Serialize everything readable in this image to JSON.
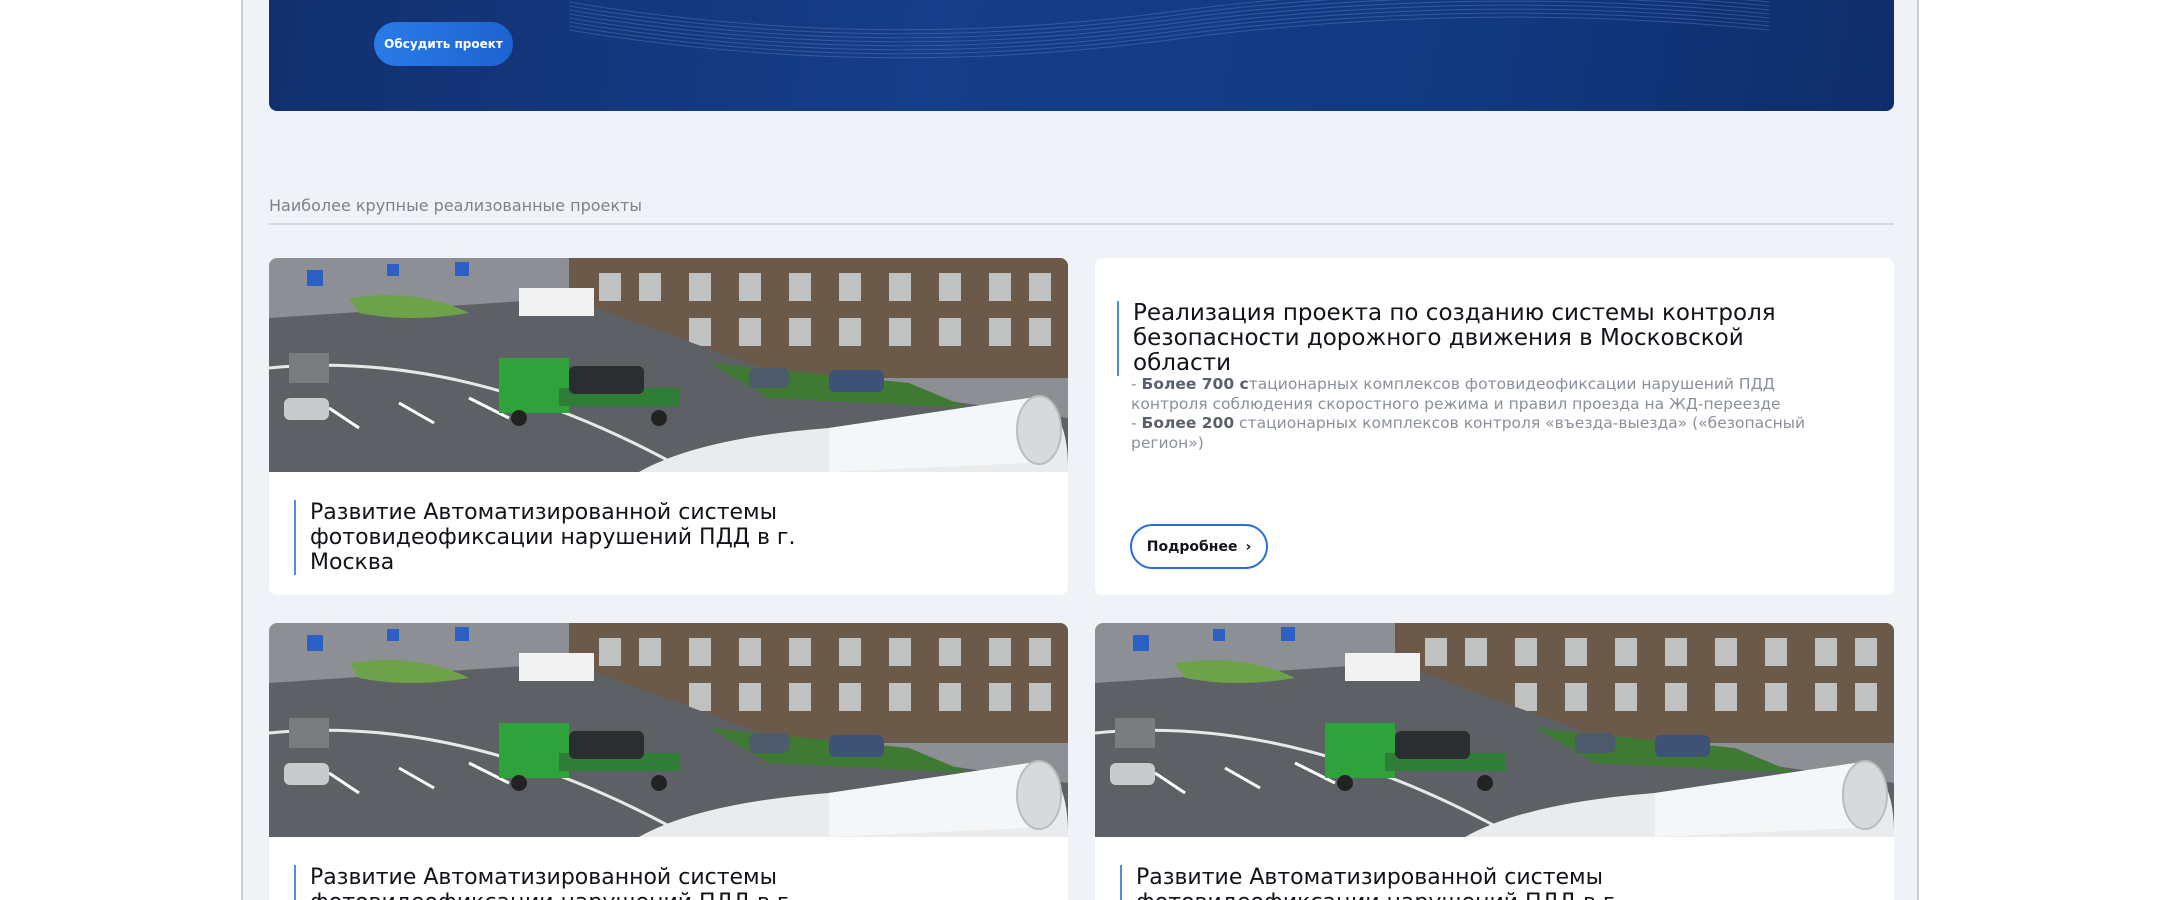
{
  "banner": {
    "discuss_button": "Обсудить проект"
  },
  "section": {
    "title": "Наиболее крупные реализованные проекты"
  },
  "cards": [
    {
      "title_line1": "Развитие Автоматизированной системы",
      "title_line2": "фотовидеофиксации нарушений ПДД в г. Москва"
    },
    {
      "title_line1": "Реализация проекта по созданию системы контроля",
      "title_line2": "безопасности дорожного движения в Московской области",
      "stat1_prefix": "- ",
      "stat1_bold": "Более 700 с",
      "stat1_rest": "тационарных комплексов фотовидеофиксации нарушений ПДД",
      "stat2": "контроля соблюдения скоростного режима и правил проезда на ЖД-переезде",
      "stat3_prefix": "- ",
      "stat3_bold": "Более 200",
      "stat3_rest": " стационарных комплексов контроля «въезда-выезда» («безопасный",
      "stat4": "регион»)",
      "more_button": "Подробнее"
    },
    {
      "title_line1": "Развитие Автоматизированной системы",
      "title_line2": "фотовидеофиксации нарушений ПДД в г. Москва"
    },
    {
      "title_line1": "Развитие Автоматизированной системы",
      "title_line2": "фотовидеофиксации нарушений ПДД в г. Москва"
    }
  ],
  "colors": {
    "banner": "#163d89",
    "accent": "#2b6fd6",
    "page_bg": "#eff2f6"
  }
}
